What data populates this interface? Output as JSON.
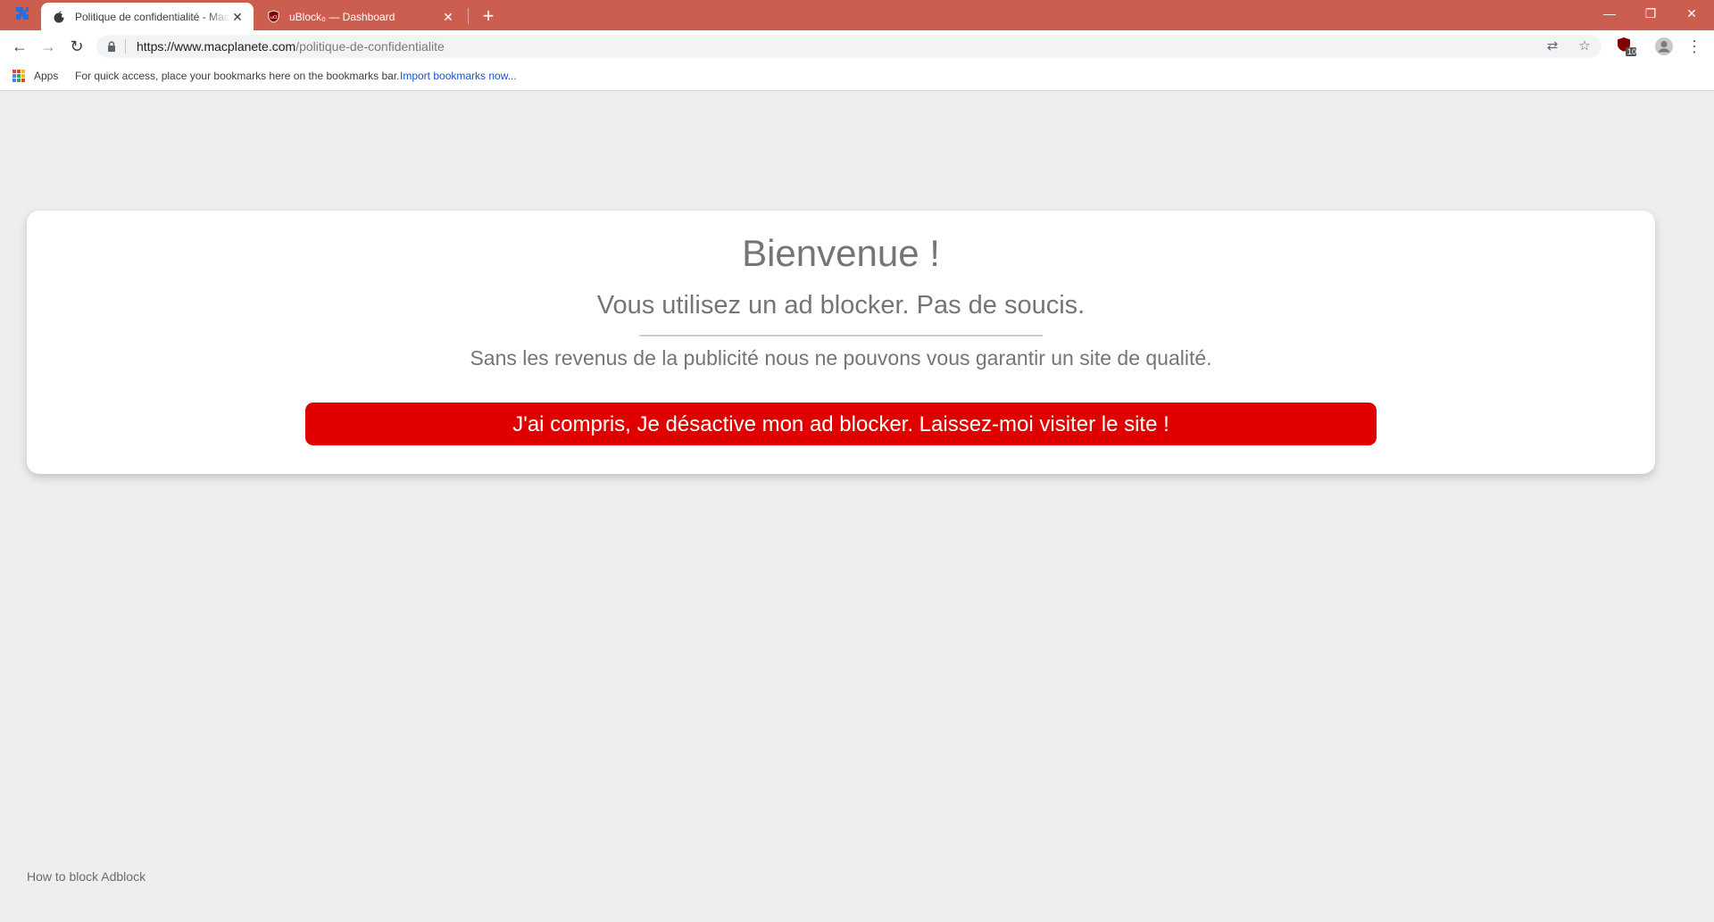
{
  "browser": {
    "tabs": [
      {
        "title": "Politique de confidentialité - MacPlanete",
        "active": true,
        "favicon": "apple-icon"
      },
      {
        "title": "uBlock₀ — Dashboard",
        "active": false,
        "favicon": "ublock-icon"
      }
    ],
    "close_glyph": "✕",
    "new_tab_glyph": "+",
    "window_controls": {
      "minimize": "—",
      "restore": "❐",
      "close": "✕"
    },
    "toolbar": {
      "back_glyph": "←",
      "forward_glyph": "→",
      "reload_glyph": "↻",
      "url_host": "https://www.macplanete.com",
      "url_path": "/politique-de-confidentialite",
      "translate_glyph": "⇄",
      "bookmark_star_glyph": "☆",
      "extension_badge": "10",
      "menu_glyph": "⋮"
    },
    "bookmarks_bar": {
      "apps_label": "Apps",
      "hint": "For quick access, place your bookmarks here on the bookmarks bar.",
      "import_link": "Import bookmarks now..."
    }
  },
  "page": {
    "title": "Bienvenue !",
    "subtitle": "Vous utilisez un ad blocker. Pas de soucis.",
    "message": "Sans les revenus de la publicité nous ne pouvons vous garantir un site de qualité.",
    "cta_label": "J'ai compris, Je désactive mon ad blocker. Laissez-moi visiter le site !",
    "footer_link": "How to block Adblock"
  },
  "colors": {
    "tabstrip": "#cc5e4f",
    "cta": "#e00000",
    "page_bg": "#eeeeee",
    "link": "#1a53c8"
  },
  "icons": [
    "puzzle-icon",
    "apple-icon",
    "ublock-icon",
    "lock-icon",
    "translate-icon",
    "star-icon",
    "apps-grid-icon",
    "profile-icon",
    "menu-icon"
  ]
}
